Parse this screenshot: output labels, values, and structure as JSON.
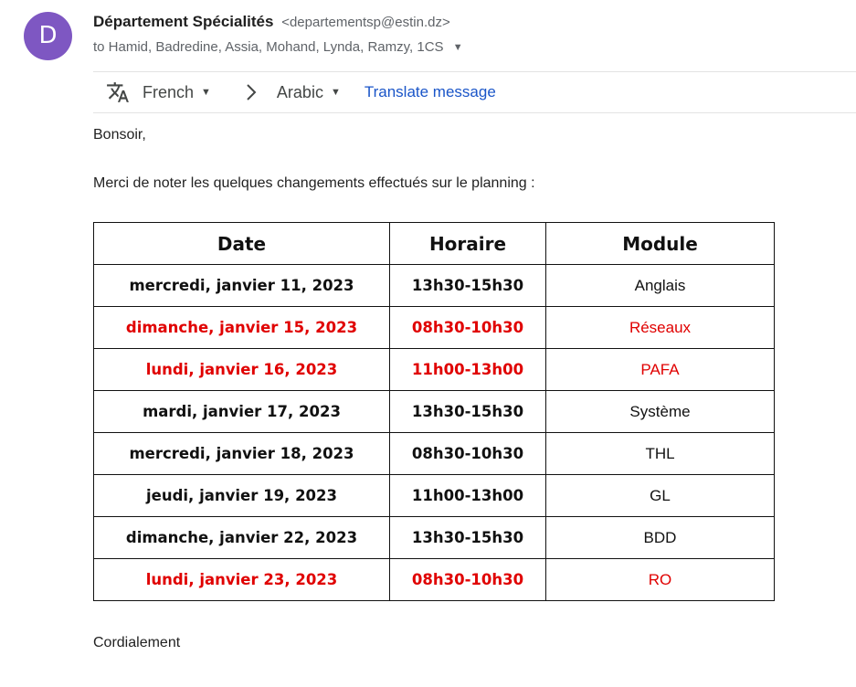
{
  "sender": {
    "avatar_letter": "D",
    "avatar_color": "#7e57c2",
    "name": "Département Spécialités",
    "email": "<departementsp@estin.dz>",
    "recipients": "to Hamid, Badredine, Assia, Mohand, Lynda, Ramzy, 1CS"
  },
  "translate": {
    "source_lang": "French",
    "target_lang": "Arabic",
    "link_label": "Translate message",
    "icon": "translate-icon"
  },
  "body": {
    "greeting": "Bonsoir,",
    "intro": "Merci de noter les quelques changements effectués sur le planning :",
    "closing": "Cordialement"
  },
  "table": {
    "headers": [
      "Date",
      "Horaire",
      "Module"
    ],
    "rows": [
      {
        "date": "mercredi, janvier 11, 2023",
        "time": "13h30-15h30",
        "module": "Anglais",
        "highlight": false
      },
      {
        "date": "dimanche, janvier 15, 2023",
        "time": "08h30-10h30",
        "module": "Réseaux",
        "highlight": true
      },
      {
        "date": "lundi, janvier 16, 2023",
        "time": "11h00-13h00",
        "module": "PAFA",
        "highlight": true
      },
      {
        "date": "mardi, janvier 17, 2023",
        "time": "13h30-15h30",
        "module": "Système",
        "highlight": false
      },
      {
        "date": "mercredi, janvier 18, 2023",
        "time": "08h30-10h30",
        "module": "THL",
        "highlight": false
      },
      {
        "date": "jeudi, janvier 19, 2023",
        "time": "11h00-13h00",
        "module": "GL",
        "highlight": false
      },
      {
        "date": "dimanche, janvier 22, 2023",
        "time": "13h30-15h30",
        "module": "BDD",
        "highlight": false
      },
      {
        "date": "lundi, janvier 23, 2023",
        "time": "08h30-10h30",
        "module": "RO",
        "highlight": true
      }
    ],
    "highlight_color": "#e00000"
  }
}
